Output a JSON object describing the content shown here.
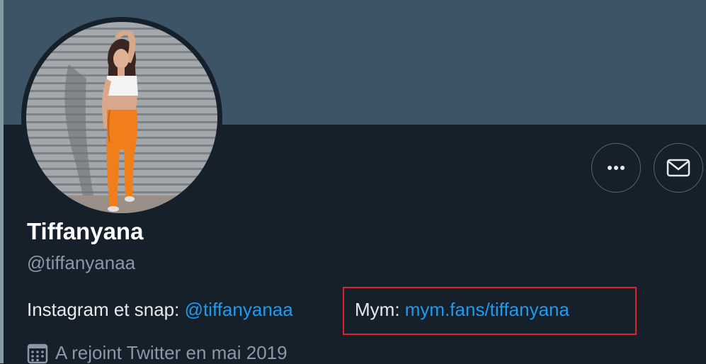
{
  "profile": {
    "display_name": "Tiffanyana",
    "handle": "@tiffanyanaa",
    "bio": {
      "instagram_prefix": "Instagram et snap: ",
      "instagram_link": "@tiffanyanaa",
      "mym_prefix": "Mym: ",
      "mym_link": "mym.fans/tiffanyana"
    },
    "joined": "A rejoint Twitter en mai 2019"
  },
  "actions": {
    "more_icon": "more-icon",
    "message_icon": "mail-icon"
  },
  "colors": {
    "background": "#15202b",
    "banner": "#3d5466",
    "link": "#1d9bf0",
    "highlight": "#e0202a",
    "secondary_text": "#8b98a5"
  }
}
